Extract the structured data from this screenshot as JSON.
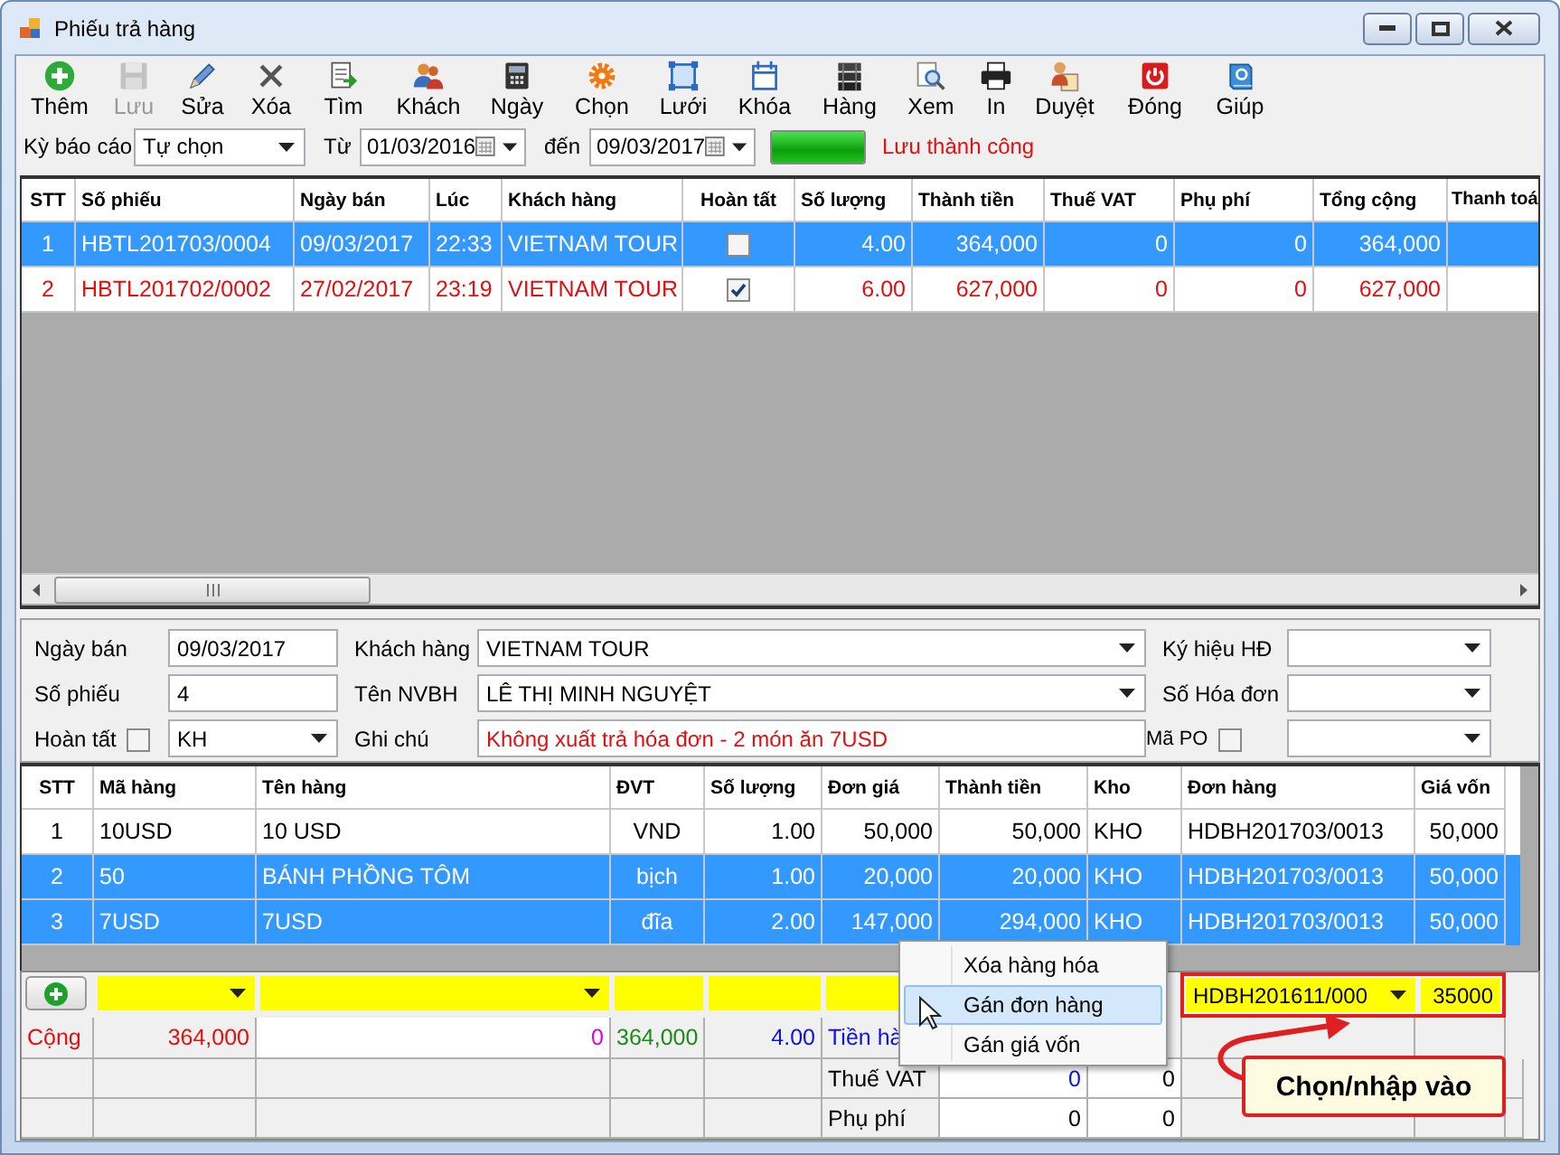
{
  "window": {
    "title": "Phiếu trả hàng"
  },
  "toolbar": [
    {
      "label": "Thêm",
      "disabled": false
    },
    {
      "label": "Lưu",
      "disabled": true
    },
    {
      "label": "Sửa",
      "disabled": false
    },
    {
      "label": "Xóa",
      "disabled": false
    },
    {
      "label": "Tìm",
      "disabled": false
    },
    {
      "label": "Khách",
      "disabled": false
    },
    {
      "label": "Ngày",
      "disabled": false
    },
    {
      "label": "Chọn",
      "disabled": false
    },
    {
      "label": "Lưới",
      "disabled": false
    },
    {
      "label": "Khóa",
      "disabled": false
    },
    {
      "label": "Hàng",
      "disabled": false
    },
    {
      "label": "Xem",
      "disabled": false
    },
    {
      "label": "In",
      "disabled": false
    },
    {
      "label": "Duyệt",
      "disabled": false
    },
    {
      "label": "Đóng",
      "disabled": false
    },
    {
      "label": "Giúp",
      "disabled": false
    }
  ],
  "filter": {
    "period_label": "Kỳ báo cáo",
    "period": "Tự chọn",
    "from_label": "Từ",
    "from": "01/03/2016",
    "to_label": "đến",
    "to": "09/03/2017",
    "progress": {
      "level": 1
    },
    "status": "Lưu thành công"
  },
  "list": {
    "columns": [
      "STT",
      "Số phiếu",
      "Ngày bán",
      "Lúc",
      "Khách hàng",
      "Hoàn tất",
      "Số lượng",
      "Thành tiền",
      "Thuế VAT",
      "Phụ phí",
      "Tổng cộng",
      "Thanh toá"
    ],
    "rows": [
      {
        "cells": [
          "1",
          "HBTL201703/0004",
          "09/03/2017",
          "22:33",
          "VIETNAM TOUR",
          "",
          "4.00",
          "364,000",
          "0",
          "0",
          "364,000"
        ],
        "completed": false,
        "selected": true
      },
      {
        "cells": [
          "2",
          "HBTL201702/0002",
          "27/02/2017",
          "23:19",
          "VIETNAM TOUR",
          "",
          "6.00",
          "627,000",
          "0",
          "0",
          "627,000"
        ],
        "completed": true,
        "selected": false
      }
    ]
  },
  "details": {
    "sale_date": {
      "label": "Ngày bán",
      "value": "09/03/2017"
    },
    "customer": {
      "label": "Khách hàng",
      "value": "VIETNAM TOUR"
    },
    "invoice_symbol": {
      "label": "Ký hiệu HĐ"
    },
    "voucher_no": {
      "label": "Số phiếu",
      "value": "4"
    },
    "staff": {
      "label": "Tên NVBH",
      "value": "LÊ THỊ MINH NGUYỆT"
    },
    "invoice_no": {
      "label": "Số Hóa đơn"
    },
    "completed": {
      "label": "Hoàn tất",
      "checked": false
    },
    "type": {
      "value": "KH"
    },
    "note": {
      "label": "Ghi chú",
      "value": "Không xuất trả hóa đơn - 2 món ăn 7USD"
    },
    "po": {
      "label": "Mã PO",
      "checked": false
    }
  },
  "items": {
    "columns": [
      "STT",
      "Mã hàng",
      "Tên hàng",
      "ĐVT",
      "Số lượng",
      "Đơn giá",
      "Thành tiền",
      "Kho",
      "Đơn hàng",
      "Giá vốn"
    ],
    "rows": [
      {
        "cells": [
          "1",
          "10USD",
          "10 USD",
          "VND",
          "1.00",
          "50,000",
          "50,000",
          "KHO",
          "HDBH201703/0013",
          "50,000"
        ],
        "selected": false
      },
      {
        "cells": [
          "2",
          "50",
          "BÁNH PHỒNG TÔM",
          "bịch",
          "1.00",
          "20,000",
          "20,000",
          "KHO",
          "HDBH201703/0013",
          "50,000"
        ],
        "selected": true
      },
      {
        "cells": [
          "3",
          "7USD",
          "7USD",
          "đĩa",
          "2.00",
          "147,000",
          "294,000",
          "KHO",
          "HDBH201703/0013",
          "50,000"
        ],
        "selected": true
      }
    ]
  },
  "entry": {
    "order": "HDBH201611/000",
    "cost": "35000"
  },
  "totals": {
    "label": "Cộng",
    "amount": "364,000",
    "discount": "0",
    "paid": "364,000",
    "quantity": "4.00",
    "goods_label": "Tiền hà"
  },
  "extras": [
    {
      "label": "Thuế VAT",
      "values": [
        "0",
        "0"
      ]
    },
    {
      "label": "Phụ phí",
      "values": [
        "0",
        "0"
      ]
    }
  ],
  "context_menu": {
    "items": [
      {
        "label": "Xóa hàng hóa",
        "selected": false
      },
      {
        "label": "Gán đơn hàng",
        "selected": true
      },
      {
        "label": "Gán giá vốn",
        "selected": false
      }
    ]
  },
  "callout": {
    "text": "Chọn/nhập vào"
  }
}
